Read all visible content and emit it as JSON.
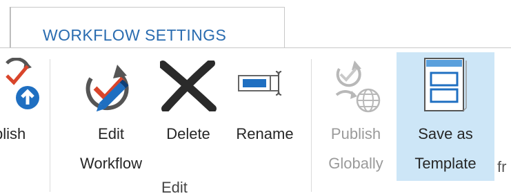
{
  "ribbon_tab": {
    "label": "WORKFLOW SETTINGS"
  },
  "buttons": {
    "publish_partial": {
      "label": "blish",
      "icon": "publish-icon"
    },
    "edit_workflow": {
      "label_line1": "Edit",
      "label_line2": "Workflow",
      "icon": "edit-workflow-icon"
    },
    "delete": {
      "label": "Delete",
      "icon": "delete-x-icon"
    },
    "rename": {
      "label": "Rename",
      "icon": "rename-icon"
    },
    "publish_globally": {
      "label_line1": "Publish",
      "label_line2": "Globally",
      "icon": "publish-globally-icon",
      "disabled": true
    },
    "save_as_template": {
      "label_line1": "Save as",
      "label_line2": "Template",
      "icon": "save-as-template-icon",
      "highlighted": true
    }
  },
  "group": {
    "label": "Edit"
  },
  "trailing_text": "fr",
  "colors": {
    "tab_text": "#2a6cb0",
    "highlight": "#cde6f7",
    "accent_red": "#d9452b",
    "accent_blue": "#1f6fc1"
  }
}
